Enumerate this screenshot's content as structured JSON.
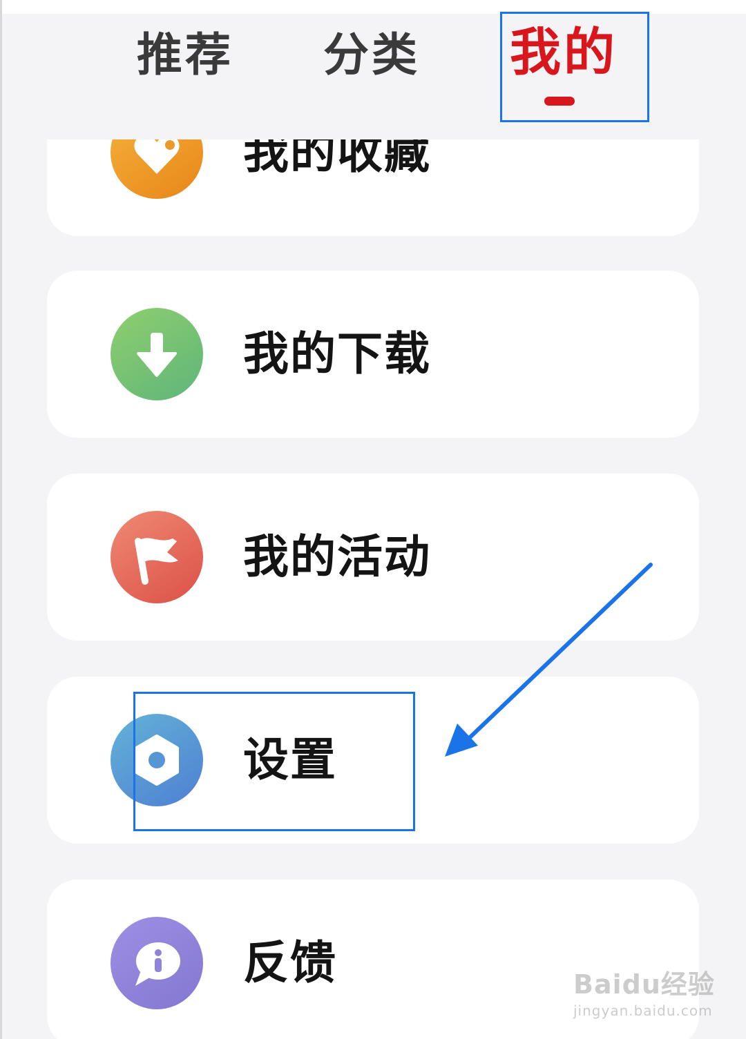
{
  "tabs": {
    "recommend": "推荐",
    "category": "分类",
    "mine": "我的"
  },
  "menu": [
    {
      "label": "我的收藏",
      "icon": "heart-tag-icon",
      "color": "#ee9a2a"
    },
    {
      "label": "我的下载",
      "icon": "download-icon",
      "color": "#77c274"
    },
    {
      "label": "我的活动",
      "icon": "flag-icon",
      "color": "#e46b5b"
    },
    {
      "label": "设置",
      "icon": "settings-icon",
      "color": "#5696d5"
    },
    {
      "label": "反馈",
      "icon": "feedback-icon",
      "color": "#8f83da"
    }
  ],
  "colors": {
    "active_tab": "#d9161c",
    "annotation": "#1a73e8",
    "background": "#f4f3f6"
  },
  "watermark": {
    "logo": "Baidu经验",
    "url": "jingyan.baidu.com"
  }
}
